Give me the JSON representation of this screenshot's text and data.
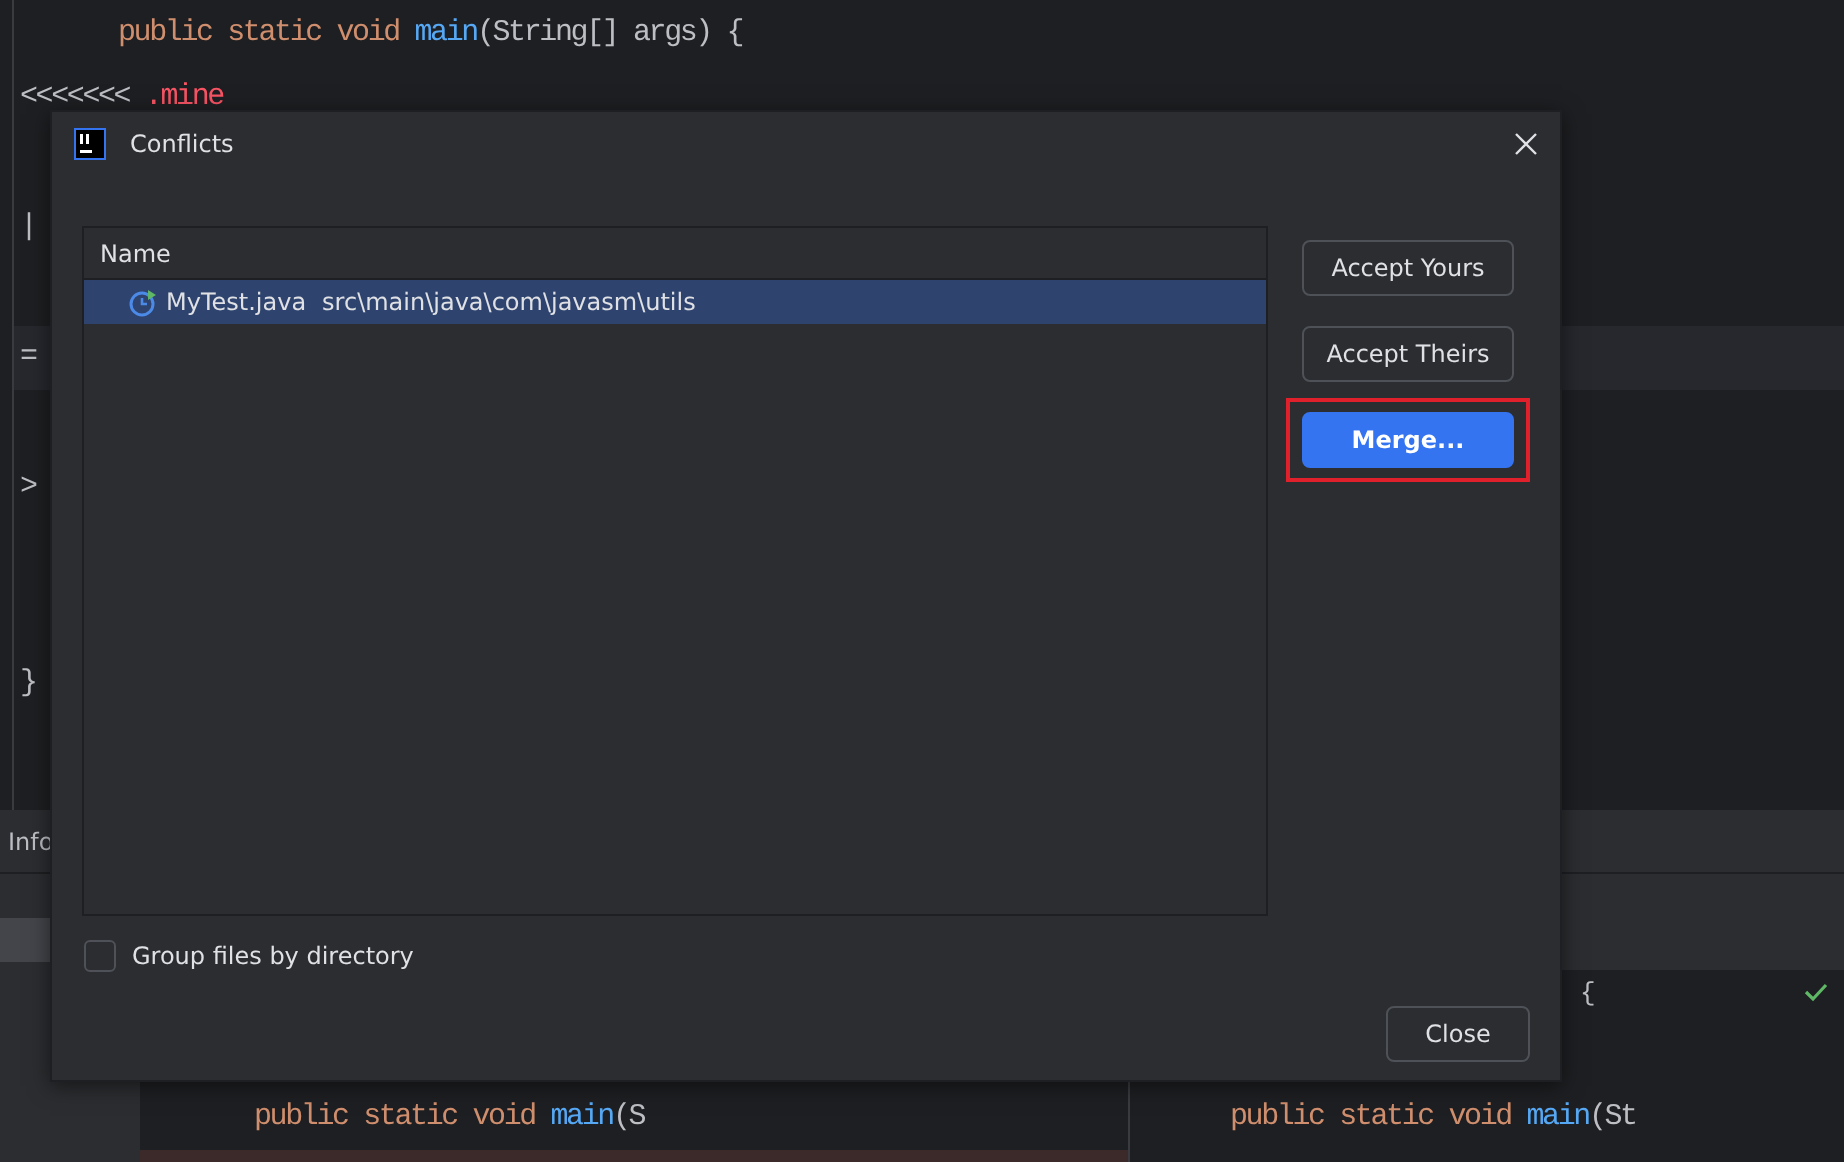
{
  "editor": {
    "lines": [
      {
        "band": false,
        "tokens": [
          {
            "text": "public static void ",
            "kind": "keyword"
          },
          {
            "text": "main",
            "kind": "method"
          },
          {
            "text": "(String[] args) {",
            "kind": "plain"
          }
        ]
      },
      {
        "band": false,
        "tokens": [
          {
            "text": "<<<<<<< ",
            "kind": "plain"
          },
          {
            "text": ".mine",
            "kind": "error"
          }
        ]
      },
      {
        "band": false,
        "tokens": [
          {
            "text": "|",
            "kind": "plain"
          }
        ]
      },
      {
        "band": true,
        "tokens": [
          {
            "text": "=",
            "kind": "plain"
          }
        ]
      },
      {
        "band": false,
        "tokens": [
          {
            "text": ">",
            "kind": "plain"
          }
        ]
      },
      {
        "band": false,
        "tokens": [
          {
            "text": "}",
            "kind": "plain"
          }
        ]
      }
    ]
  },
  "tool_window": {
    "tab": "Info"
  },
  "diff": {
    "left": {
      "tokens": [
        {
          "text": "public static void ",
          "kind": "keyword"
        },
        {
          "text": "main",
          "kind": "method"
        },
        {
          "text": "(S",
          "kind": "plain"
        }
      ]
    },
    "right": {
      "top": "{",
      "tokens": [
        {
          "text": "public static void ",
          "kind": "keyword"
        },
        {
          "text": "main",
          "kind": "method"
        },
        {
          "text": "(St",
          "kind": "plain"
        }
      ]
    }
  },
  "dialog": {
    "title": "Conflicts",
    "table": {
      "columns": [
        "Name"
      ],
      "rows": [
        {
          "file": "MyTest.java",
          "path": "src\\main\\java\\com\\javasm\\utils",
          "selected": true
        }
      ]
    },
    "buttons": [
      {
        "label": "Accept Yours",
        "kind": "default",
        "highlighted": false
      },
      {
        "label": "Accept Theirs",
        "kind": "default",
        "highlighted": false
      },
      {
        "label": "Merge...",
        "kind": "primary",
        "highlighted": true
      }
    ],
    "group_by_directory": {
      "label": "Group files by directory",
      "checked": false
    },
    "close_button": "Close"
  }
}
